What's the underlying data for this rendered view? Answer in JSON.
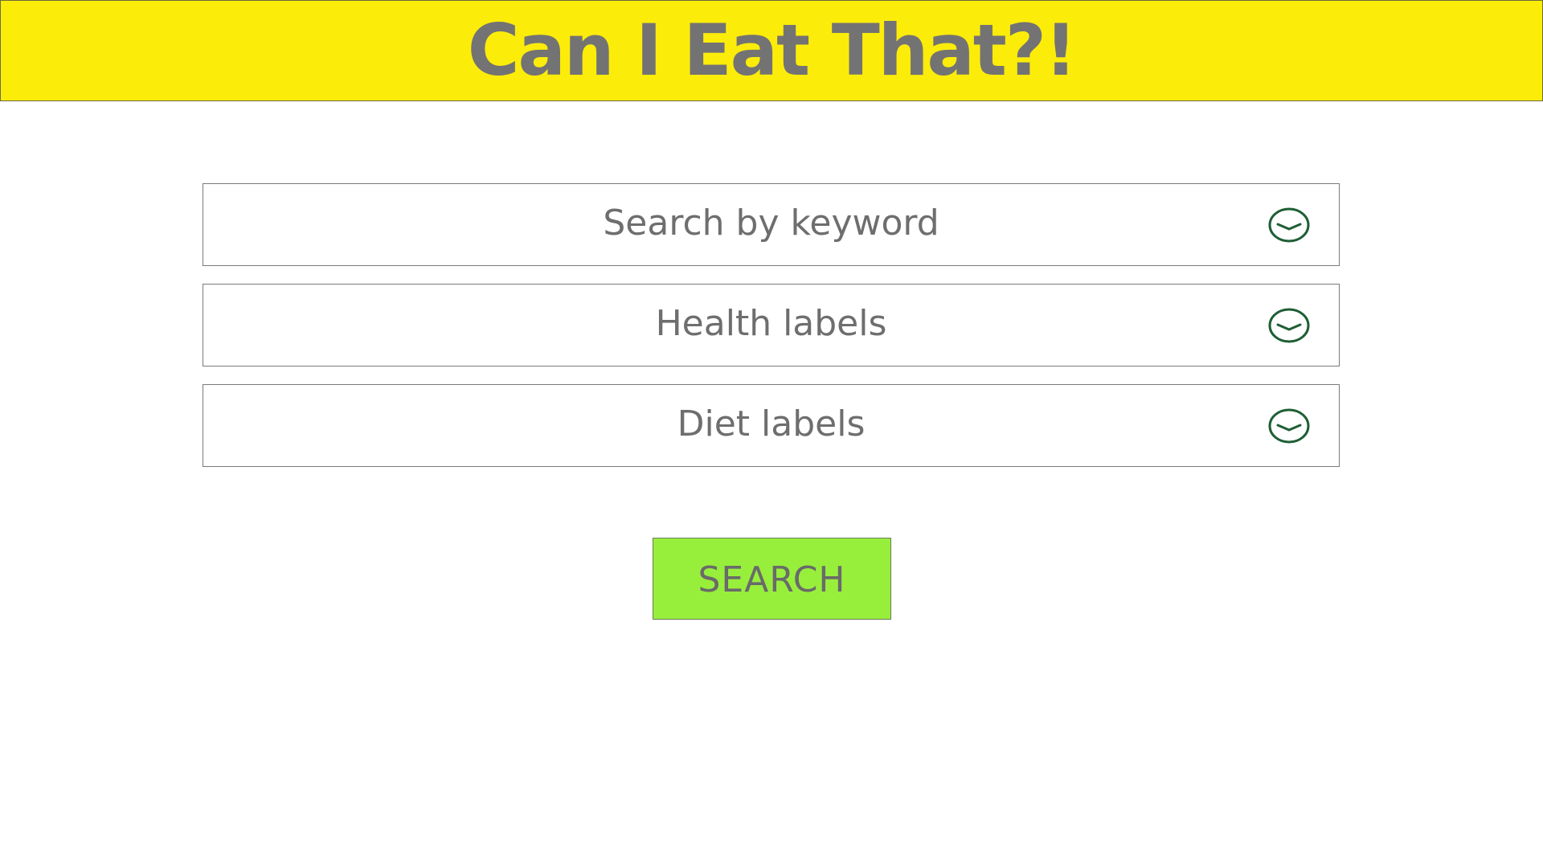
{
  "header": {
    "title": "Can I Eat That?!",
    "background": "#fcec0a"
  },
  "form": {
    "fields": [
      {
        "label": "Search by keyword",
        "icon": "chevron-down-circle-icon"
      },
      {
        "label": "Health labels",
        "icon": "chevron-down-circle-icon"
      },
      {
        "label": "Diet labels",
        "icon": "chevron-down-circle-icon"
      }
    ],
    "search_label": "SEARCH",
    "search_color": "#97ef3c",
    "icon_color": "#1e5e34"
  }
}
